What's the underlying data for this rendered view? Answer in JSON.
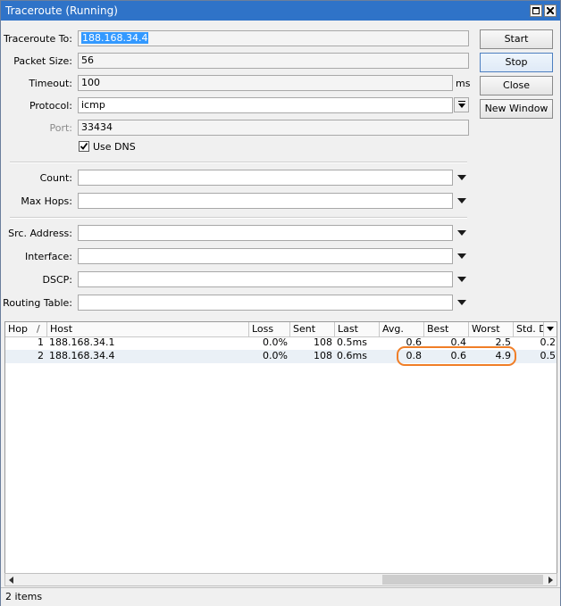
{
  "window": {
    "title": "Traceroute (Running)"
  },
  "form": {
    "traceroute_to_label": "Traceroute To:",
    "traceroute_to_value": "188.168.34.4",
    "packet_size_label": "Packet Size:",
    "packet_size_value": "56",
    "timeout_label": "Timeout:",
    "timeout_value": "100",
    "timeout_unit": "ms",
    "protocol_label": "Protocol:",
    "protocol_value": "icmp",
    "port_label": "Port:",
    "port_value": "33434",
    "use_dns_label": "Use DNS",
    "use_dns_checked": true,
    "count_label": "Count:",
    "count_value": "",
    "max_hops_label": "Max Hops:",
    "max_hops_value": "",
    "src_address_label": "Src. Address:",
    "src_address_value": "",
    "interface_label": "Interface:",
    "interface_value": "",
    "dscp_label": "DSCP:",
    "dscp_value": "",
    "routing_table_label": "Routing Table:",
    "routing_table_value": ""
  },
  "buttons": {
    "start": "Start",
    "stop": "Stop",
    "close": "Close",
    "new_window": "New Window"
  },
  "table": {
    "columns": {
      "hop": "Hop",
      "sort_indicator": "/",
      "host": "Host",
      "loss": "Loss",
      "sent": "Sent",
      "last": "Last",
      "avg": "Avg.",
      "best": "Best",
      "worst": "Worst",
      "std_dev": "Std. De"
    },
    "rows": [
      {
        "hop": "1",
        "host": "188.168.34.1",
        "loss": "0.0%",
        "sent": "108",
        "last": "0.5ms",
        "avg": "0.6",
        "best": "0.4",
        "worst": "2.5",
        "std_dev": "0.2"
      },
      {
        "hop": "2",
        "host": "188.168.34.4",
        "loss": "0.0%",
        "sent": "108",
        "last": "0.6ms",
        "avg": "0.8",
        "best": "0.6",
        "worst": "4.9",
        "std_dev": "0.5"
      }
    ]
  },
  "status": {
    "items": "2 items"
  },
  "colors": {
    "titlebar": "#2f73c8",
    "annotation": "#f07e27",
    "selection": "#3399ff"
  }
}
